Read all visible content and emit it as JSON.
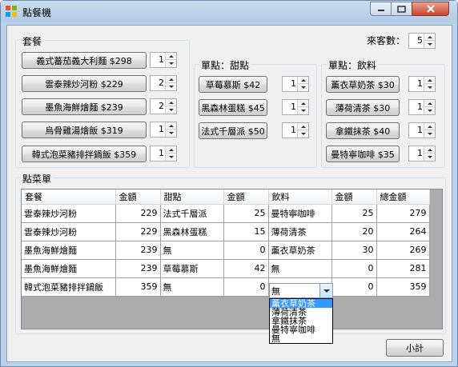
{
  "window": {
    "title": "點餐機"
  },
  "guests": {
    "label": "來客數：",
    "value": "5"
  },
  "sets": {
    "label": "套餐",
    "items": [
      {
        "label": "義式蕃茄義大利麵 $298",
        "qty": "1"
      },
      {
        "label": "雲泰辣炒河粉 $229",
        "qty": "2"
      },
      {
        "label": "墨魚海鮮燴麵 $239",
        "qty": "2"
      },
      {
        "label": "烏骨雞湯燴飯 $319",
        "qty": "1"
      },
      {
        "label": "韓式泡菜豬排拌鍋飯 $359",
        "qty": "1"
      }
    ]
  },
  "desserts": {
    "label": "單點：甜點",
    "items": [
      {
        "label": "草莓慕斯 $42",
        "qty": "1"
      },
      {
        "label": "黑森林蛋糕 $45",
        "qty": "1"
      },
      {
        "label": "法式千層派 $50",
        "qty": "1"
      }
    ]
  },
  "drinks": {
    "label": "單點：飲料",
    "items": [
      {
        "label": "薰衣草奶茶 $30",
        "qty": "1"
      },
      {
        "label": "薄荷清茶 $30",
        "qty": "1"
      },
      {
        "label": "拿鐵抹茶 $40",
        "qty": "1"
      },
      {
        "label": "曼特寧咖啡 $35",
        "qty": "1"
      }
    ]
  },
  "orders": {
    "label": "點菜單",
    "columns": [
      "套餐",
      "金額",
      "甜點",
      "金額",
      "飲料",
      "金額",
      "總金額"
    ],
    "rows": [
      [
        "雲泰辣炒河粉",
        "229",
        "法式千層派",
        "25",
        "曼特寧咖啡",
        "25",
        "279"
      ],
      [
        "雲泰辣炒河粉",
        "229",
        "黑森林蛋糕",
        "15",
        "薄荷清茶",
        "20",
        "264"
      ],
      [
        "墨魚海鮮燴麵",
        "239",
        "無",
        "0",
        "薰衣草奶茶",
        "30",
        "269"
      ],
      [
        "墨魚海鮮燴麵",
        "239",
        "草莓慕斯",
        "42",
        "無",
        "0",
        "281"
      ],
      [
        "韓式泡菜豬排拌鍋飯",
        "359",
        "無",
        "0",
        "",
        "0",
        "359"
      ]
    ]
  },
  "drink_combo": {
    "value": "無",
    "options": [
      "薰衣草奶茶",
      "薄荷清茶",
      "拿鐵抹茶",
      "曼特寧咖啡",
      "無"
    ],
    "selected_index": 0
  },
  "subtotal": {
    "label": "小計"
  },
  "icons": [
    "app-icon",
    "minimize-icon",
    "maximize-icon",
    "close-icon",
    "chevron-up-icon",
    "chevron-down-icon"
  ]
}
